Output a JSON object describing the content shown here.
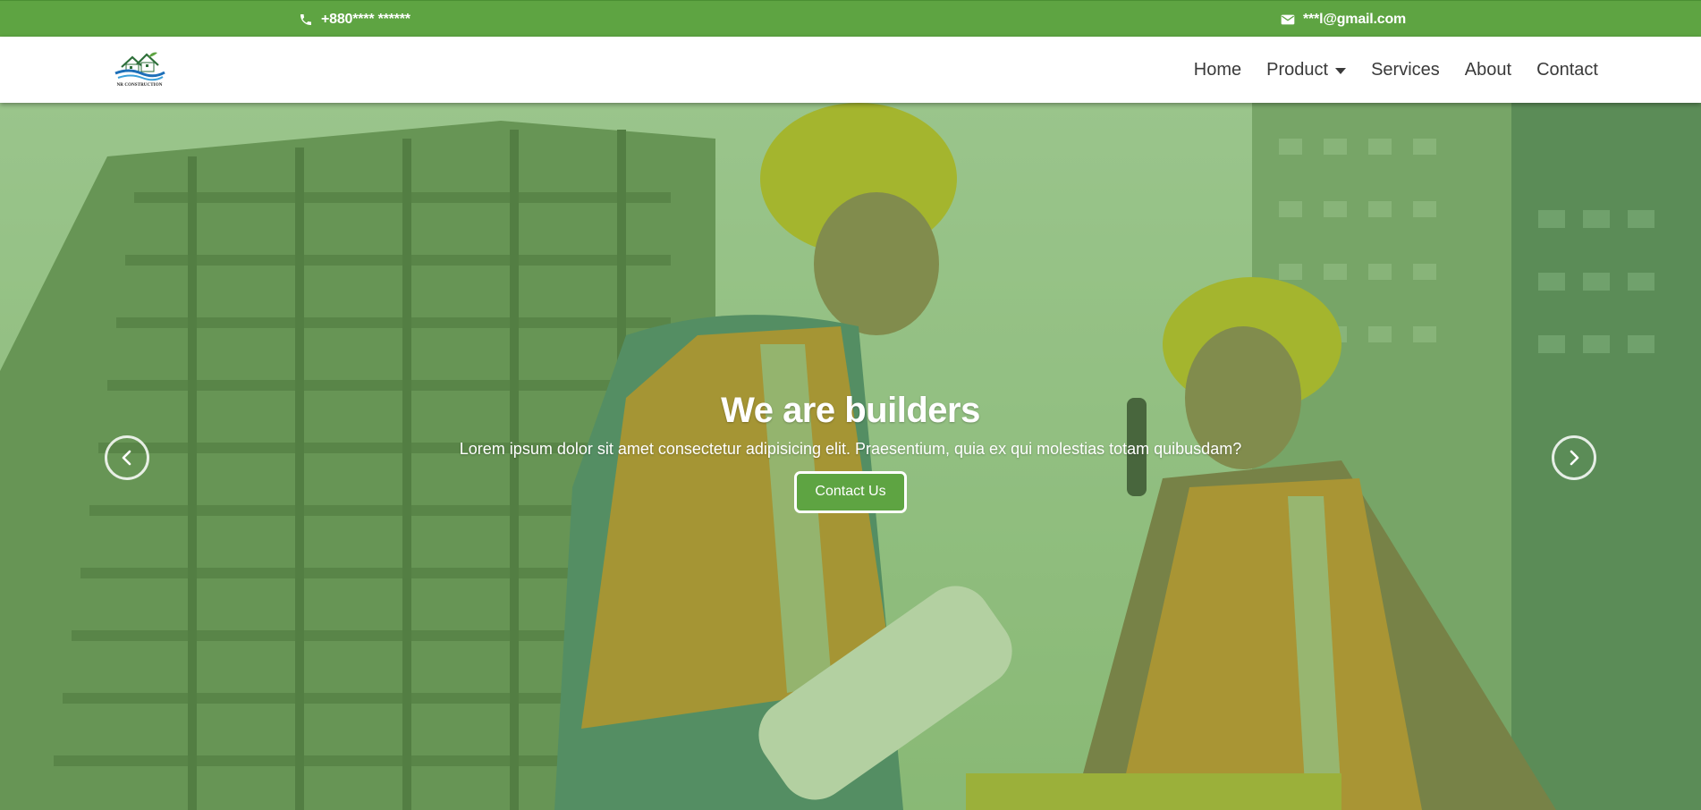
{
  "colors": {
    "accent": "#5ea442",
    "nav_text": "#3a3a3a",
    "white": "#ffffff"
  },
  "topbar": {
    "phone": {
      "icon": "phone-icon",
      "text": "+880**** ******"
    },
    "email": {
      "icon": "envelope-icon",
      "text": "***l@gmail.com"
    }
  },
  "navbar": {
    "logo": {
      "icon": "house-logo-icon",
      "text": "NR CONSTRUCTION"
    },
    "items": [
      {
        "label": "Home"
      },
      {
        "label": "Product",
        "has_dropdown": true
      },
      {
        "label": "Services"
      },
      {
        "label": "About"
      },
      {
        "label": "Contact"
      }
    ]
  },
  "hero": {
    "title": "We are builders",
    "subtitle": "Lorem ipsum dolor sit amet consectetur adipisicing elit. Praesentium, quia ex qui molestias totam quibusdam?",
    "cta_label": "Contact Us",
    "prev_icon": "chevron-left-icon",
    "next_icon": "chevron-right-icon"
  }
}
